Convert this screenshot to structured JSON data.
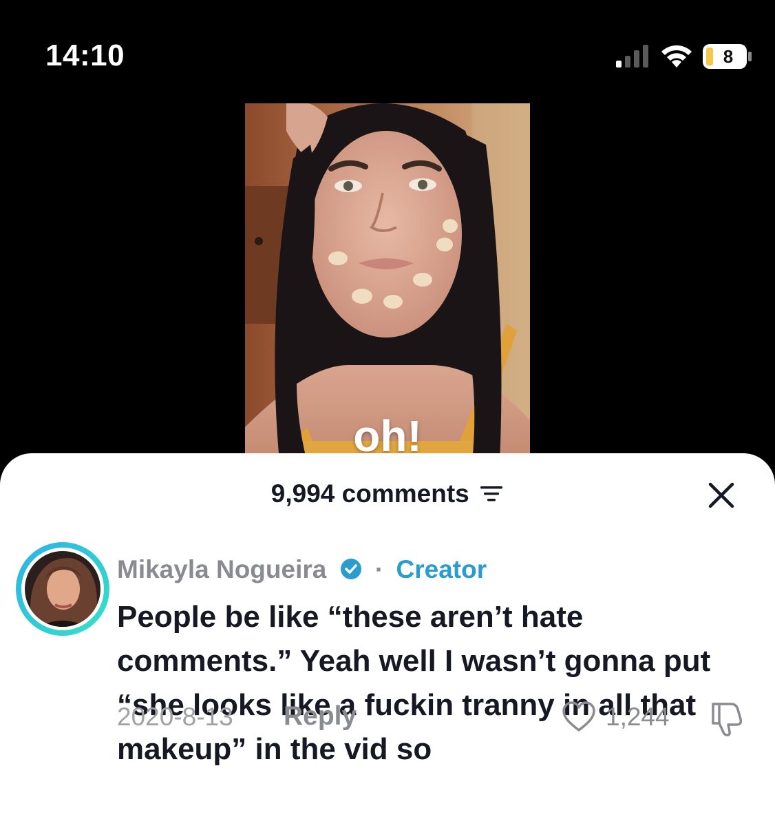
{
  "status_bar": {
    "time": "14:10",
    "battery_level": "8",
    "icons": [
      "signal-icon",
      "wifi-icon",
      "battery-icon"
    ]
  },
  "video": {
    "caption": "oh!"
  },
  "comments_sheet": {
    "count_label": "9,994 comments",
    "icons": [
      "sort-icon",
      "close-icon"
    ]
  },
  "comment": {
    "author": "Mikayla Nogueira",
    "separator": "·",
    "badge": "Creator",
    "text": "People be like “these aren’t hate comments.” Yeah well I wasn’t gonna put “she looks like a fuckin tranny in all that makeup” in the vid so",
    "date": "2020-8-13",
    "reply_label": "Reply",
    "like_count": "1,244",
    "icons": [
      "verified-icon",
      "heart-icon",
      "dislike-icon"
    ]
  },
  "colors": {
    "background": "#000000",
    "sheet": "#ffffff",
    "primary_text": "#161823",
    "secondary_text": "#8a8b91",
    "creator_accent": "#2a9cd0",
    "battery_fill": "#f5c84b"
  }
}
